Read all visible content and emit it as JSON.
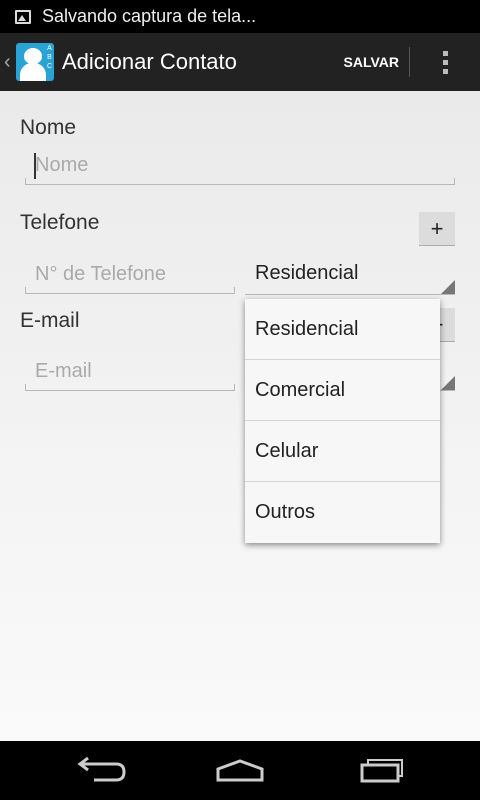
{
  "status_bar": {
    "notification_icon": "image-icon",
    "text": "Salvando captura de tela..."
  },
  "action_bar": {
    "title": "Adicionar Contato",
    "save_label": "SALVAR",
    "app_icon_letters": [
      "A",
      "B",
      "C"
    ]
  },
  "form": {
    "name": {
      "label": "Nome",
      "placeholder": "Nome"
    },
    "phone": {
      "label": "Telefone",
      "placeholder": "N° de Telefone",
      "add_label": "+",
      "type_value": "Residencial"
    },
    "email": {
      "label": "E-mail",
      "placeholder": "E-mail",
      "add_label": "+"
    }
  },
  "dropdown": {
    "options": [
      "Residencial",
      "Comercial",
      "Celular",
      "Outros"
    ]
  },
  "nav_bar": {
    "icons": [
      "back-icon",
      "home-icon",
      "recent-apps-icon"
    ]
  }
}
